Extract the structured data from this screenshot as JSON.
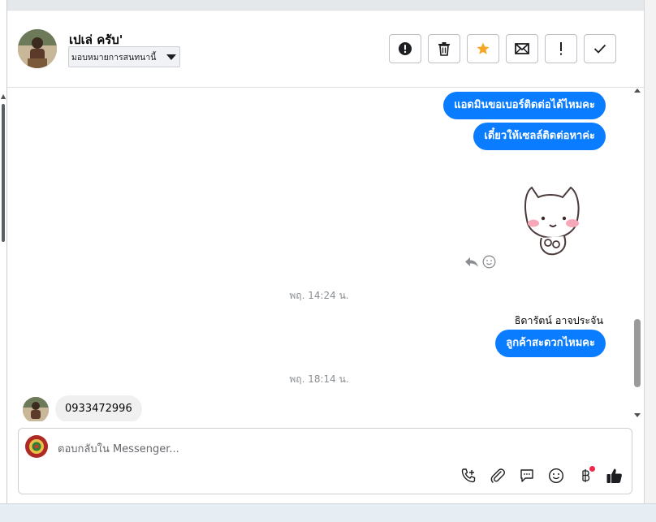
{
  "header": {
    "contact_name": "เปเล่ ครับ'",
    "assign_label": "มอบหมายการสนทนานี้",
    "toolbar": [
      {
        "name": "mark-spam-button",
        "icon": "alert-circle-icon"
      },
      {
        "name": "delete-button",
        "icon": "trash-icon"
      },
      {
        "name": "star-button",
        "icon": "star-icon"
      },
      {
        "name": "mark-unread-button",
        "icon": "envelope-icon"
      },
      {
        "name": "follow-up-button",
        "icon": "exclamation-icon"
      },
      {
        "name": "mark-done-button",
        "icon": "check-icon"
      }
    ]
  },
  "conversation": {
    "out_messages": [
      "แอดมินขอเบอร์ติดต่อได้ไหมคะ",
      "เดี๋ยวให้เซลล์ติดต่อหาค่ะ"
    ],
    "timestamp_1": "พฤ. 14:24 น.",
    "sender_name": "ธิดารัตน์ อาจประจัน",
    "out_message_3": "ลูกค้าสะดวกไหมคะ",
    "timestamp_2": "พฤ. 18:14 น.",
    "in_message": "0933472996"
  },
  "composer": {
    "placeholder": "ตอบกลับใน Messenger..."
  },
  "colors": {
    "accent": "#0a7cff",
    "star": "#f5a623",
    "notification": "#f02849"
  }
}
